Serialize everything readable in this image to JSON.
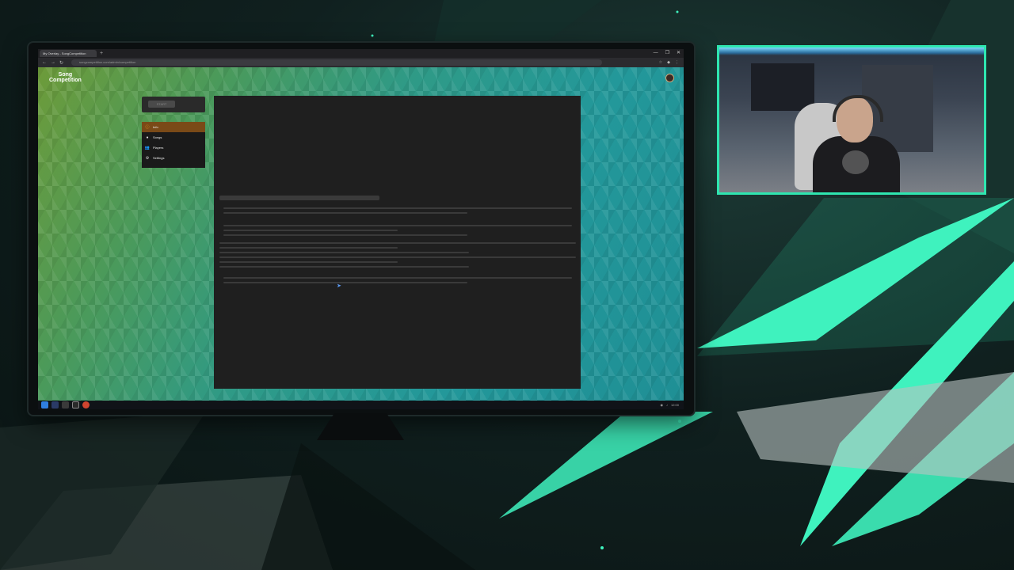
{
  "browser": {
    "tab_title": "My Overlay - SongCompetition",
    "new_tab_label": "+",
    "url": "songcompetition.com/admin/competition",
    "window_controls": [
      "—",
      "❐",
      "✕"
    ]
  },
  "app": {
    "logo_line1": "Song",
    "logo_line2": "Competition",
    "start_button_label": "START",
    "menu": [
      {
        "label": "Info",
        "icon": "info-icon",
        "glyph": "ⓘ",
        "active": true
      },
      {
        "label": "Songs",
        "icon": "music-icon",
        "glyph": "●",
        "active": false
      },
      {
        "label": "Players",
        "icon": "users-icon",
        "glyph": "👥",
        "active": false
      },
      {
        "label": "Settings",
        "icon": "gear-icon",
        "glyph": "⚙",
        "active": false
      }
    ]
  },
  "taskbar": {
    "clock": "12:00"
  },
  "colors": {
    "webcam_border": "#2ee6b0",
    "menu_active": "#7a4a17",
    "menu_active_icon": "#f6a623",
    "page_gradient_start": "#6d9b3a",
    "page_gradient_end": "#1f8f95"
  }
}
